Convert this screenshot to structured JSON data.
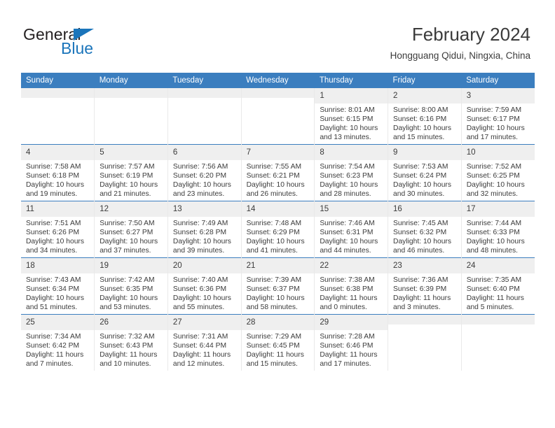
{
  "brand": {
    "name_part1": "General",
    "name_part2": "Blue",
    "triangle_icon": "triangle-icon",
    "accent_color": "#1b75bb"
  },
  "header": {
    "title": "February 2024",
    "location": "Hongguang Qidui, Ningxia, China"
  },
  "calendar": {
    "header_bg": "#3b7ebf",
    "daynum_bg": "#efefef",
    "weekdays": [
      "Sunday",
      "Monday",
      "Tuesday",
      "Wednesday",
      "Thursday",
      "Friday",
      "Saturday"
    ],
    "weeks": [
      [
        {
          "day": "",
          "empty": true
        },
        {
          "day": "",
          "empty": true
        },
        {
          "day": "",
          "empty": true
        },
        {
          "day": "",
          "empty": true
        },
        {
          "day": "1",
          "sunrise": "Sunrise: 8:01 AM",
          "sunset": "Sunset: 6:15 PM",
          "daylight": "Daylight: 10 hours and 13 minutes."
        },
        {
          "day": "2",
          "sunrise": "Sunrise: 8:00 AM",
          "sunset": "Sunset: 6:16 PM",
          "daylight": "Daylight: 10 hours and 15 minutes."
        },
        {
          "day": "3",
          "sunrise": "Sunrise: 7:59 AM",
          "sunset": "Sunset: 6:17 PM",
          "daylight": "Daylight: 10 hours and 17 minutes."
        }
      ],
      [
        {
          "day": "4",
          "sunrise": "Sunrise: 7:58 AM",
          "sunset": "Sunset: 6:18 PM",
          "daylight": "Daylight: 10 hours and 19 minutes."
        },
        {
          "day": "5",
          "sunrise": "Sunrise: 7:57 AM",
          "sunset": "Sunset: 6:19 PM",
          "daylight": "Daylight: 10 hours and 21 minutes."
        },
        {
          "day": "6",
          "sunrise": "Sunrise: 7:56 AM",
          "sunset": "Sunset: 6:20 PM",
          "daylight": "Daylight: 10 hours and 23 minutes."
        },
        {
          "day": "7",
          "sunrise": "Sunrise: 7:55 AM",
          "sunset": "Sunset: 6:21 PM",
          "daylight": "Daylight: 10 hours and 26 minutes."
        },
        {
          "day": "8",
          "sunrise": "Sunrise: 7:54 AM",
          "sunset": "Sunset: 6:23 PM",
          "daylight": "Daylight: 10 hours and 28 minutes."
        },
        {
          "day": "9",
          "sunrise": "Sunrise: 7:53 AM",
          "sunset": "Sunset: 6:24 PM",
          "daylight": "Daylight: 10 hours and 30 minutes."
        },
        {
          "day": "10",
          "sunrise": "Sunrise: 7:52 AM",
          "sunset": "Sunset: 6:25 PM",
          "daylight": "Daylight: 10 hours and 32 minutes."
        }
      ],
      [
        {
          "day": "11",
          "sunrise": "Sunrise: 7:51 AM",
          "sunset": "Sunset: 6:26 PM",
          "daylight": "Daylight: 10 hours and 34 minutes."
        },
        {
          "day": "12",
          "sunrise": "Sunrise: 7:50 AM",
          "sunset": "Sunset: 6:27 PM",
          "daylight": "Daylight: 10 hours and 37 minutes."
        },
        {
          "day": "13",
          "sunrise": "Sunrise: 7:49 AM",
          "sunset": "Sunset: 6:28 PM",
          "daylight": "Daylight: 10 hours and 39 minutes."
        },
        {
          "day": "14",
          "sunrise": "Sunrise: 7:48 AM",
          "sunset": "Sunset: 6:29 PM",
          "daylight": "Daylight: 10 hours and 41 minutes."
        },
        {
          "day": "15",
          "sunrise": "Sunrise: 7:46 AM",
          "sunset": "Sunset: 6:31 PM",
          "daylight": "Daylight: 10 hours and 44 minutes."
        },
        {
          "day": "16",
          "sunrise": "Sunrise: 7:45 AM",
          "sunset": "Sunset: 6:32 PM",
          "daylight": "Daylight: 10 hours and 46 minutes."
        },
        {
          "day": "17",
          "sunrise": "Sunrise: 7:44 AM",
          "sunset": "Sunset: 6:33 PM",
          "daylight": "Daylight: 10 hours and 48 minutes."
        }
      ],
      [
        {
          "day": "18",
          "sunrise": "Sunrise: 7:43 AM",
          "sunset": "Sunset: 6:34 PM",
          "daylight": "Daylight: 10 hours and 51 minutes."
        },
        {
          "day": "19",
          "sunrise": "Sunrise: 7:42 AM",
          "sunset": "Sunset: 6:35 PM",
          "daylight": "Daylight: 10 hours and 53 minutes."
        },
        {
          "day": "20",
          "sunrise": "Sunrise: 7:40 AM",
          "sunset": "Sunset: 6:36 PM",
          "daylight": "Daylight: 10 hours and 55 minutes."
        },
        {
          "day": "21",
          "sunrise": "Sunrise: 7:39 AM",
          "sunset": "Sunset: 6:37 PM",
          "daylight": "Daylight: 10 hours and 58 minutes."
        },
        {
          "day": "22",
          "sunrise": "Sunrise: 7:38 AM",
          "sunset": "Sunset: 6:38 PM",
          "daylight": "Daylight: 11 hours and 0 minutes."
        },
        {
          "day": "23",
          "sunrise": "Sunrise: 7:36 AM",
          "sunset": "Sunset: 6:39 PM",
          "daylight": "Daylight: 11 hours and 3 minutes."
        },
        {
          "day": "24",
          "sunrise": "Sunrise: 7:35 AM",
          "sunset": "Sunset: 6:40 PM",
          "daylight": "Daylight: 11 hours and 5 minutes."
        }
      ],
      [
        {
          "day": "25",
          "sunrise": "Sunrise: 7:34 AM",
          "sunset": "Sunset: 6:42 PM",
          "daylight": "Daylight: 11 hours and 7 minutes."
        },
        {
          "day": "26",
          "sunrise": "Sunrise: 7:32 AM",
          "sunset": "Sunset: 6:43 PM",
          "daylight": "Daylight: 11 hours and 10 minutes."
        },
        {
          "day": "27",
          "sunrise": "Sunrise: 7:31 AM",
          "sunset": "Sunset: 6:44 PM",
          "daylight": "Daylight: 11 hours and 12 minutes."
        },
        {
          "day": "28",
          "sunrise": "Sunrise: 7:29 AM",
          "sunset": "Sunset: 6:45 PM",
          "daylight": "Daylight: 11 hours and 15 minutes."
        },
        {
          "day": "29",
          "sunrise": "Sunrise: 7:28 AM",
          "sunset": "Sunset: 6:46 PM",
          "daylight": "Daylight: 11 hours and 17 minutes."
        },
        {
          "day": "",
          "empty": true
        },
        {
          "day": "",
          "empty": true
        }
      ]
    ]
  }
}
